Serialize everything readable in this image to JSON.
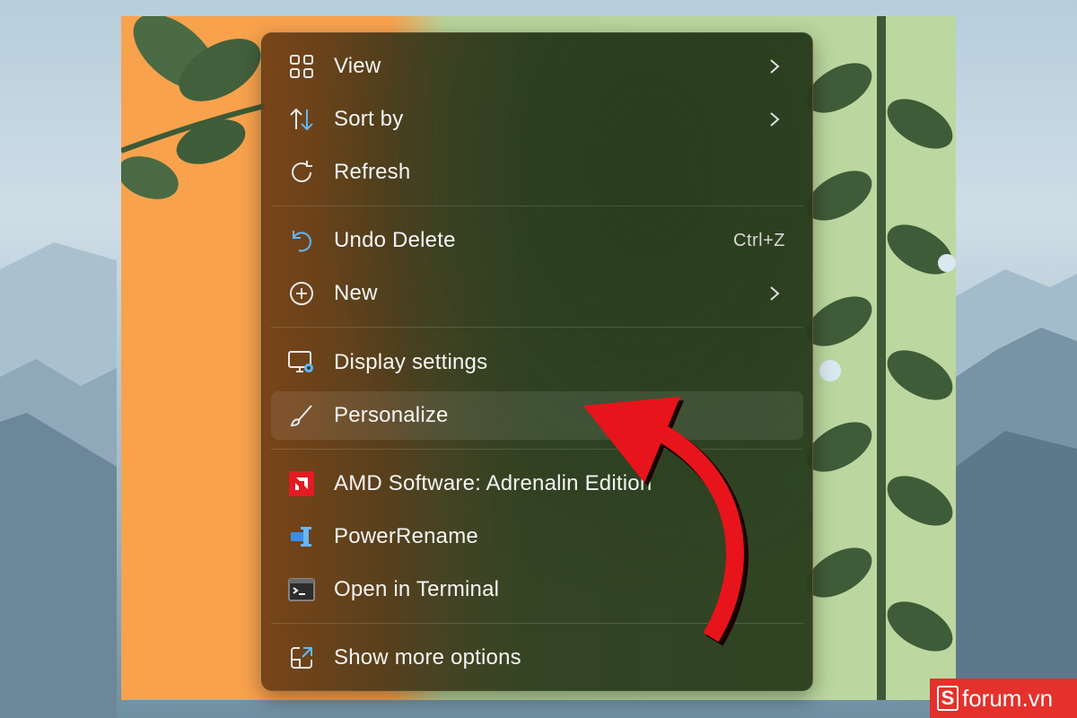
{
  "context_menu": {
    "items": [
      {
        "label": "View",
        "icon": "grid-view-icon",
        "has_submenu": true
      },
      {
        "label": "Sort by",
        "icon": "sort-arrows-icon",
        "has_submenu": true
      },
      {
        "label": "Refresh",
        "icon": "refresh-icon",
        "has_submenu": false
      },
      {
        "label": "Undo Delete",
        "icon": "undo-icon",
        "shortcut": "Ctrl+Z"
      },
      {
        "label": "New",
        "icon": "plus-circle-icon",
        "has_submenu": true
      },
      {
        "label": "Display settings",
        "icon": "display-settings-icon"
      },
      {
        "label": "Personalize",
        "icon": "brush-icon",
        "highlighted": true
      },
      {
        "label": "AMD Software: Adrenalin Edition",
        "icon": "amd-logo-icon"
      },
      {
        "label": "PowerRename",
        "icon": "powerrename-icon"
      },
      {
        "label": "Open in Terminal",
        "icon": "terminal-icon"
      },
      {
        "label": "Show more options",
        "icon": "show-more-options-icon"
      }
    ]
  },
  "watermark": {
    "logo_letter": "S",
    "text": "forum.vn",
    "color": "#e4312b"
  },
  "annotation": {
    "arrow_color": "#e8141b",
    "points_to": "Personalize"
  }
}
